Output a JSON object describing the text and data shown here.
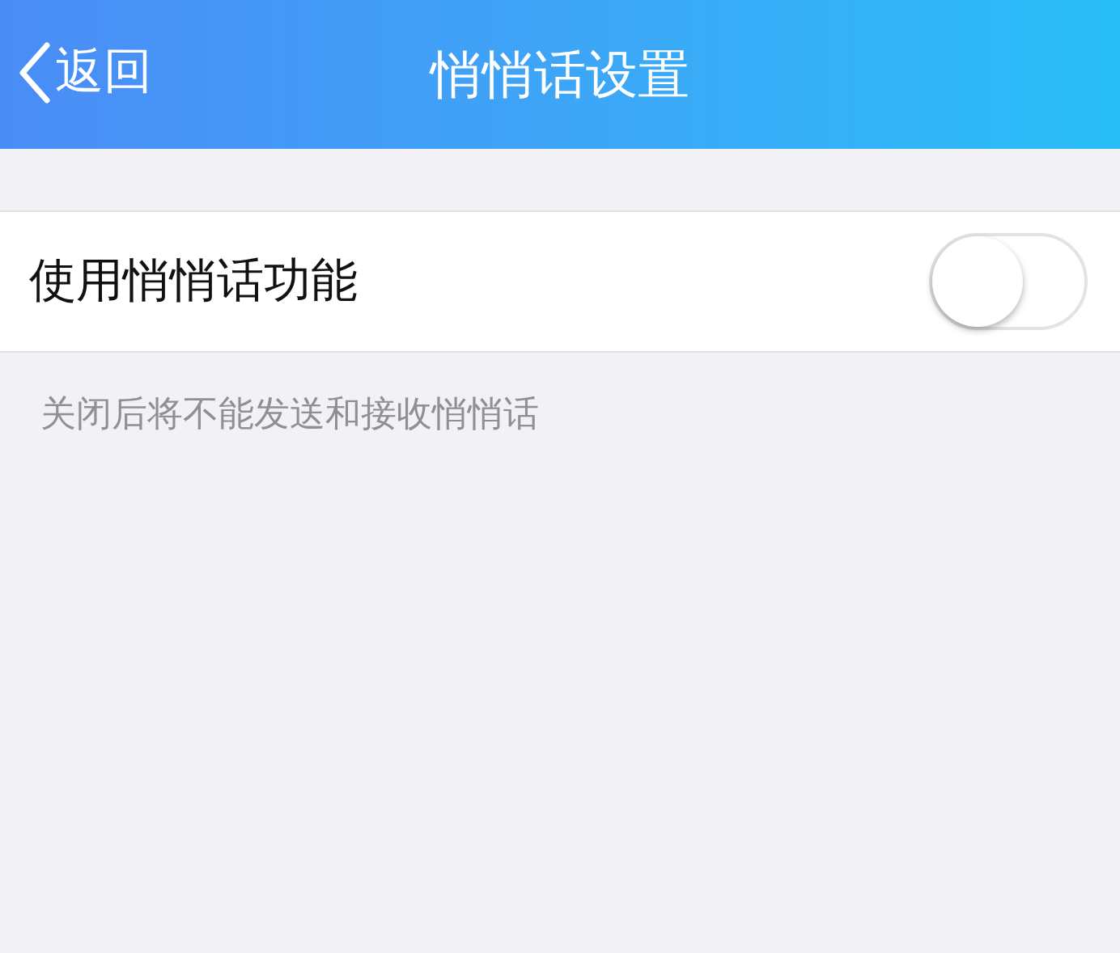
{
  "nav_bar": {
    "back": "返回",
    "title": "悄悄话设置"
  },
  "setting": {
    "label": "使用悄悄话功能",
    "on": false
  },
  "note": "关闭后将不能发送和接收悄悄话"
}
